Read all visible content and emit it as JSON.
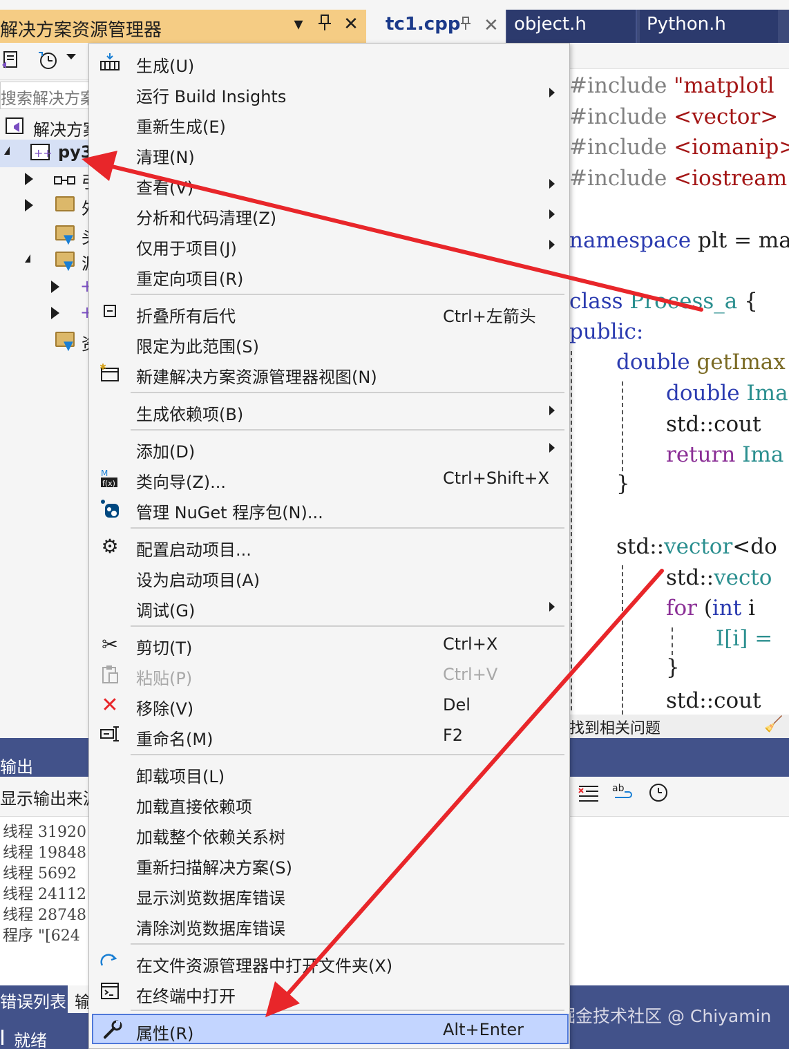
{
  "solution_explorer": {
    "title": "解决方案资源管理器",
    "controls": [
      "▾",
      "📌",
      "✕"
    ],
    "search_placeholder": "搜索解决方案",
    "tree": [
      {
        "label": "解决方案",
        "level": 0
      },
      {
        "label": "py3",
        "level": 0
      },
      {
        "label": "引",
        "level": 1
      },
      {
        "label": "外",
        "level": 1
      },
      {
        "label": "头",
        "level": 1
      },
      {
        "label": "源",
        "level": 1
      },
      {
        "label": "+",
        "level": 2
      },
      {
        "label": "+",
        "level": 2
      },
      {
        "label": "资",
        "level": 1
      }
    ]
  },
  "editor": {
    "tabs": [
      {
        "label": "tc1.cpp",
        "active": true
      },
      {
        "label": "object.h",
        "active": false
      },
      {
        "label": "Python.h",
        "active": false
      }
    ],
    "code": {
      "l1_kw": "#include",
      "l1_val": " \"matplotl",
      "l2_kw": "#include",
      "l2_val": " <vector>",
      "l3_kw": "#include",
      "l3_val": " <iomanip>",
      "l4_kw": "#include",
      "l4_val": " <iostream",
      "l5_kw": "namespace",
      "l5_val": " plt = ma",
      "l6_kw": "class",
      "l6_name": " Process_a",
      "l6_rest": " {",
      "l7": "public:",
      "l8_ty": "double",
      "l8_fn": " getImax",
      "l9_ty": "double",
      "l9_rest": " Ima",
      "l10": "std::cout",
      "l11_kw": "return",
      "l11_rest": " Ima",
      "l12": "}",
      "l13_a": "std::",
      "l13_b": "vector",
      "l13_c": "<do",
      "l14_a": "std::",
      "l14_b": "vecto",
      "l15_kw": "for",
      "l15_rest": " (",
      "l15_ty": "int",
      "l15_end": " i",
      "l16": "I[i] =",
      "l17": "}",
      "l18": "std::cout"
    },
    "issues_text": "找到相关问题"
  },
  "output": {
    "title": "输出",
    "source_label": "显示输出来源",
    "lines": [
      "线程 31920",
      "线程 19848",
      "线程 5692",
      "线程 24112",
      "线程 28748",
      "程序 \"[624"
    ],
    "bottom_tabs": [
      "错误列表",
      "输"
    ],
    "status": "就绪"
  },
  "menu": {
    "items": [
      {
        "label": "生成(U)",
        "shortcut": "",
        "icon": "build-icon",
        "submenu": false
      },
      {
        "label": "运行 Build Insights",
        "shortcut": "",
        "icon": "",
        "submenu": true
      },
      {
        "label": "重新生成(E)",
        "shortcut": "",
        "icon": "",
        "submenu": false
      },
      {
        "label": "清理(N)",
        "shortcut": "",
        "icon": "",
        "submenu": false
      },
      {
        "label": "查看(V)",
        "shortcut": "",
        "icon": "",
        "submenu": true
      },
      {
        "label": "分析和代码清理(Z)",
        "shortcut": "",
        "icon": "",
        "submenu": true
      },
      {
        "label": "仅用于项目(J)",
        "shortcut": "",
        "icon": "",
        "submenu": true
      },
      {
        "label": "重定向项目(R)",
        "shortcut": "",
        "icon": "",
        "submenu": false
      },
      {
        "label": "折叠所有后代",
        "shortcut": "Ctrl+左箭头",
        "icon": "collapse-icon",
        "submenu": false
      },
      {
        "label": "限定为此范围(S)",
        "shortcut": "",
        "icon": "",
        "submenu": false
      },
      {
        "label": "新建解决方案资源管理器视图(N)",
        "shortcut": "",
        "icon": "new-view-icon",
        "submenu": false
      },
      {
        "label": "生成依赖项(B)",
        "shortcut": "",
        "icon": "",
        "submenu": true
      },
      {
        "label": "添加(D)",
        "shortcut": "",
        "icon": "",
        "submenu": true
      },
      {
        "label": "类向导(Z)...",
        "shortcut": "Ctrl+Shift+X",
        "icon": "class-wizard-icon",
        "submenu": false
      },
      {
        "label": "管理 NuGet 程序包(N)...",
        "shortcut": "",
        "icon": "nuget-icon",
        "submenu": false
      },
      {
        "label": "配置启动项目...",
        "shortcut": "",
        "icon": "gear-icon",
        "submenu": false
      },
      {
        "label": "设为启动项目(A)",
        "shortcut": "",
        "icon": "",
        "submenu": false
      },
      {
        "label": "调试(G)",
        "shortcut": "",
        "icon": "",
        "submenu": true
      },
      {
        "label": "剪切(T)",
        "shortcut": "Ctrl+X",
        "icon": "scissors-icon",
        "submenu": false
      },
      {
        "label": "粘贴(P)",
        "shortcut": "Ctrl+V",
        "icon": "paste-icon",
        "submenu": false,
        "disabled": true
      },
      {
        "label": "移除(V)",
        "shortcut": "Del",
        "icon": "remove-icon",
        "submenu": false
      },
      {
        "label": "重命名(M)",
        "shortcut": "F2",
        "icon": "rename-icon",
        "submenu": false
      },
      {
        "label": "卸载项目(L)",
        "shortcut": "",
        "icon": "",
        "submenu": false
      },
      {
        "label": "加载直接依赖项",
        "shortcut": "",
        "icon": "",
        "submenu": false
      },
      {
        "label": "加载整个依赖关系树",
        "shortcut": "",
        "icon": "",
        "submenu": false
      },
      {
        "label": "重新扫描解决方案(S)",
        "shortcut": "",
        "icon": "",
        "submenu": false
      },
      {
        "label": "显示浏览数据库错误",
        "shortcut": "",
        "icon": "",
        "submenu": false
      },
      {
        "label": "清除浏览数据库错误",
        "shortcut": "",
        "icon": "",
        "submenu": false
      },
      {
        "label": "在文件资源管理器中打开文件夹(X)",
        "shortcut": "",
        "icon": "open-folder-icon",
        "submenu": false
      },
      {
        "label": "在终端中打开",
        "shortcut": "",
        "icon": "terminal-icon",
        "submenu": false
      },
      {
        "label": "属性(R)",
        "shortcut": "Alt+Enter",
        "icon": "wrench-icon",
        "submenu": false,
        "selected": true
      }
    ]
  },
  "watermark": "掘金技术社区 @ Chiyamin",
  "colors": {
    "title_active": "#f5cc84",
    "vs_blue": "#42528a",
    "arrow_red": "#e8262a",
    "menu_selected": "#c3d5ff"
  }
}
